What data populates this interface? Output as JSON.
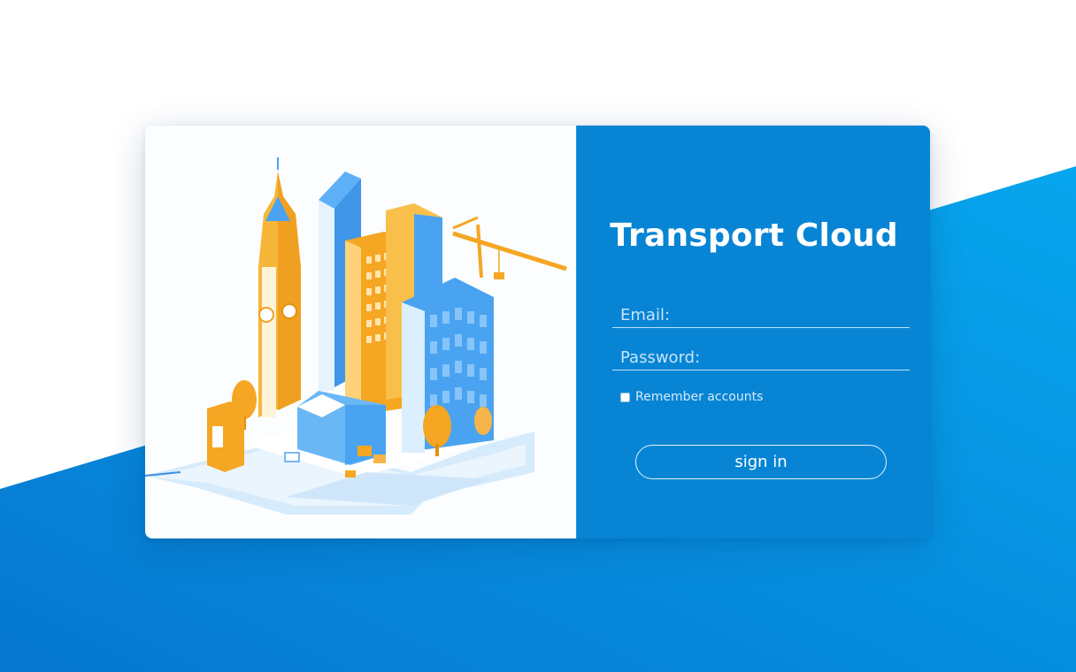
{
  "app": {
    "title": "Transport Cloud"
  },
  "form": {
    "email": {
      "placeholder": "Email:",
      "value": ""
    },
    "password": {
      "placeholder": "Password:",
      "value": ""
    },
    "remember_label": "Remember accounts",
    "remember_checked": false,
    "signin_label": "sign in"
  },
  "illustration": {
    "name": "isometric-city-illustration"
  },
  "colors": {
    "panel": "#0785d4",
    "background_wedge": "#0596e4",
    "accent_orange": "#f5a623",
    "building_blue": "#4aa3f0"
  }
}
